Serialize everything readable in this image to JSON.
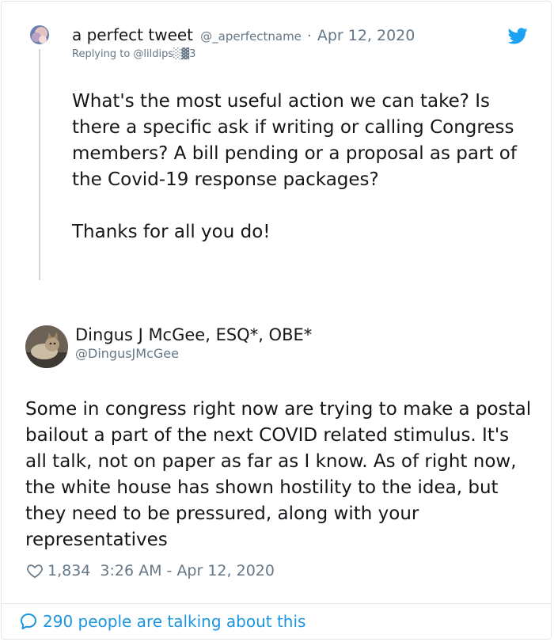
{
  "reply_tweet": {
    "author_name": "a perfect tweet",
    "handle": "@_aperfectname",
    "separator": "·",
    "date": "Apr 12, 2020",
    "replying_to": "Replying to @lildips░▓3",
    "body": "What's the most useful action we can take? Is there a specific ask if writing or calling Congress members? A bill pending or a proposal as part of the Covid-19 response packages?\n\nThanks for all you do!"
  },
  "main_tweet": {
    "author_name": "Dingus J McGee, ESQ*, OBE*",
    "handle": "@DingusJMcGee",
    "body": "Some in congress right now are trying to make a postal bailout a part of the next COVID related stimulus. It's all talk, not on paper as far as I know. As of right now, the white house has shown hostility to the idea, but they need to be pressured, along with your representatives",
    "likes": "1,834",
    "timestamp": "3:26 AM - Apr 12, 2020"
  },
  "footer": {
    "talking_text": "290 people are talking about this"
  },
  "icons": {
    "brand": "twitter-bird-icon",
    "like": "heart-icon",
    "conversation": "speech-bubble-icon"
  },
  "colors": {
    "brand_blue": "#1da1f2",
    "link_blue": "#1b95e0",
    "secondary_text": "#657786",
    "border": "#e1e8ed"
  }
}
